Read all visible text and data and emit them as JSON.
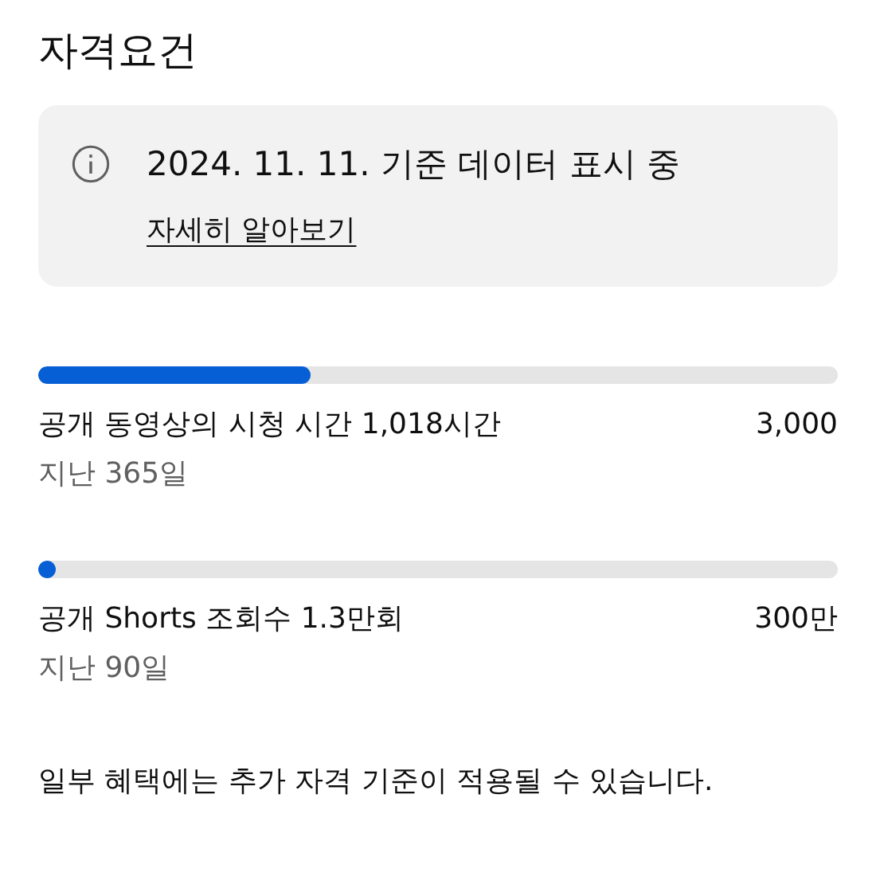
{
  "title": "자격요건",
  "notice": {
    "text": "2024. 11. 11. 기준 데이터 표시 중",
    "link": "자세히 알아보기"
  },
  "requirements": [
    {
      "label": "공개 동영상의 시청 시간 1,018시간",
      "target": "3,000",
      "period": "지난 365일",
      "level": 0.34
    },
    {
      "label": "공개 Shorts 조회수 1.3만회",
      "target": "300만",
      "period": "지난 90일",
      "level": 0.004
    }
  ],
  "footnote": "일부 혜택에는 추가 자격 기준이 적용될 수 있습니다."
}
